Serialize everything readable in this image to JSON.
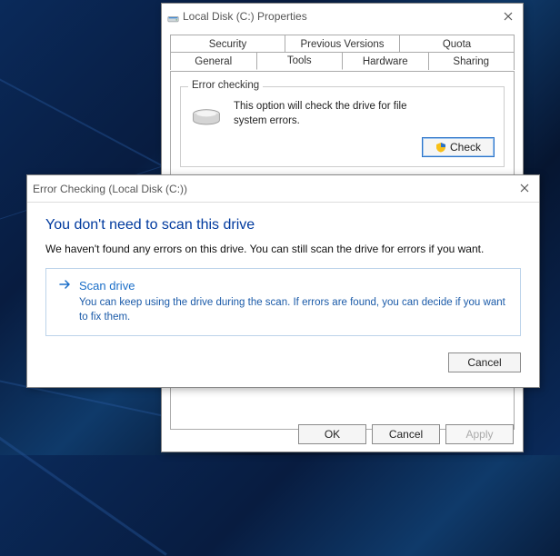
{
  "properties": {
    "title": "Local Disk (C:) Properties",
    "tabs_row1": [
      "Security",
      "Previous Versions",
      "Quota"
    ],
    "tabs_row2": [
      "General",
      "Tools",
      "Hardware",
      "Sharing"
    ],
    "active_tab": "Tools",
    "error_checking": {
      "legend": "Error checking",
      "text": "This option will check the drive for file system errors.",
      "button": "Check"
    },
    "footer": {
      "ok": "OK",
      "cancel": "Cancel",
      "apply": "Apply"
    }
  },
  "dialog": {
    "title": "Error Checking (Local Disk (C:))",
    "headline": "You don't need to scan this drive",
    "subtext": "We haven't found any errors on this drive. You can still scan the drive for errors if you want.",
    "option": {
      "title": "Scan drive",
      "desc": "You can keep using the drive during the scan. If errors are found, you can decide if you want to fix them."
    },
    "cancel": "Cancel"
  }
}
